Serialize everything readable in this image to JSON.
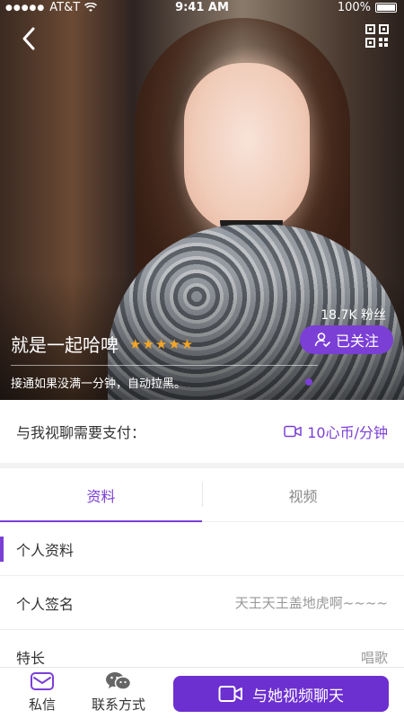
{
  "status_bar": {
    "carrier": "AT&T",
    "time": "9:41 AM",
    "battery": "100%"
  },
  "profile": {
    "fans": "18.7K 粉丝",
    "nickname": "就是一起哈啤",
    "stars": "★★★★★",
    "follow_label": "已关注",
    "description": "接通如果没满一分钟，自动拉黑。"
  },
  "price": {
    "label": "与我视聊需要支付：",
    "value": "10心币/分钟"
  },
  "tabs": [
    {
      "label": "资料",
      "active": true
    },
    {
      "label": "视频",
      "active": false
    }
  ],
  "section": {
    "title": "个人资料"
  },
  "info_rows": [
    {
      "key": "个人签名",
      "value": "天王天王盖地虎啊~~~~"
    },
    {
      "key": "特长",
      "value": "唱歌"
    }
  ],
  "bottom_bar": {
    "message_label": "私信",
    "contact_label": "联系方式",
    "video_chat_label": "与她视频聊天"
  },
  "colors": {
    "accent": "#7b3fd6",
    "star": "#f6a623"
  }
}
